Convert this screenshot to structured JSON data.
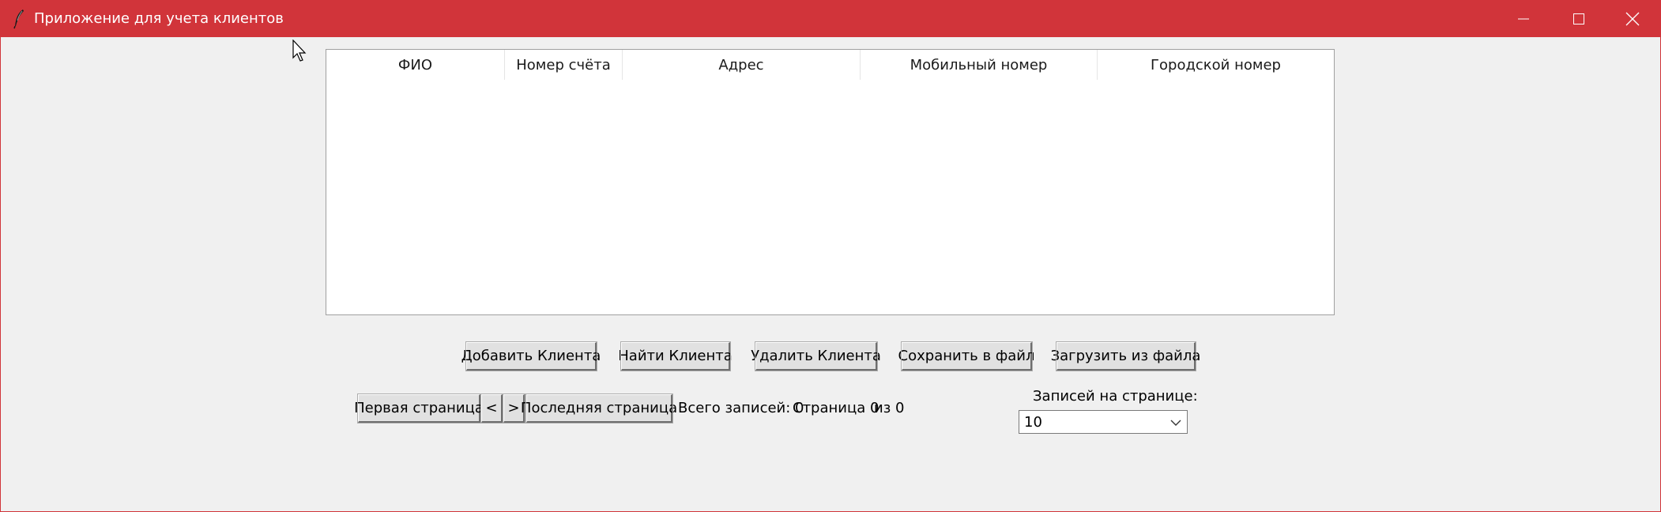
{
  "window": {
    "title": "Приложение для учета клиентов",
    "icons": {
      "app": "feather-icon",
      "minimize": "minimize-icon",
      "maximize": "maximize-icon",
      "close": "close-icon"
    },
    "colors": {
      "titlebar": "#d1343a",
      "background": "#f0f0f0"
    }
  },
  "table": {
    "columns": [
      "ФИО",
      "Номер счёта",
      "Адрес",
      "Мобильный номер",
      "Городской номер"
    ],
    "rows": []
  },
  "actions": {
    "add_label": "Добавить Клиента",
    "find_label": "Найти Клиента",
    "delete_label": "Удалить Клиента",
    "save_label": "Сохранить в файл",
    "load_label": "Загрузить из файла"
  },
  "pagination": {
    "first_label": "Первая страница",
    "prev_label": "<",
    "next_label": ">",
    "last_label": "Последняя страница",
    "total_text": "Всего записей: 0",
    "page_text": "Страница 0",
    "of_text": "из 0",
    "per_page_label": "Записей на странице:",
    "per_page_value": "10"
  }
}
